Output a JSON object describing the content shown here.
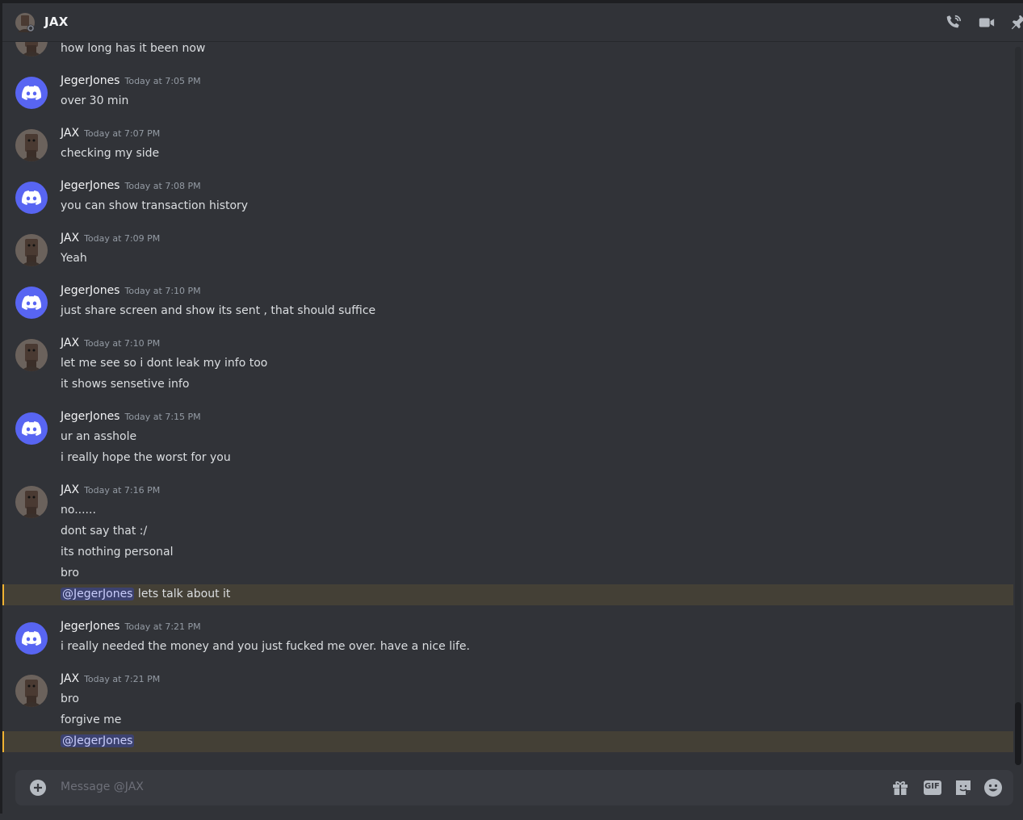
{
  "header": {
    "title": "JAX",
    "icons": [
      "phone-call-icon",
      "video-call-icon",
      "pin-icon"
    ]
  },
  "messages": [
    {
      "author": "",
      "time": "",
      "lines": [
        "how long has it been now"
      ]
    },
    {
      "author": "JegerJones",
      "time": "Today at 7:05 PM",
      "lines": [
        "over 30 min"
      ]
    },
    {
      "author": "JAX",
      "time": "Today at 7:07 PM",
      "lines": [
        "checking my side"
      ]
    },
    {
      "author": "JegerJones",
      "time": "Today at 7:08 PM",
      "lines": [
        "you can show transaction history"
      ]
    },
    {
      "author": "JAX",
      "time": "Today at 7:09 PM",
      "lines": [
        "Yeah"
      ]
    },
    {
      "author": "JegerJones",
      "time": "Today at 7:10 PM",
      "lines": [
        "just share screen and show its sent , that should suffice"
      ]
    },
    {
      "author": "JAX",
      "time": "Today at 7:10 PM",
      "lines": [
        "let me see so i dont leak my info too",
        "it shows sensetive info"
      ]
    },
    {
      "author": "JegerJones",
      "time": "Today at 7:15 PM",
      "lines": [
        "ur an asshole",
        "i really hope the worst for you"
      ]
    },
    {
      "author": "JAX",
      "time": "Today at 7:16 PM",
      "lines": [
        "no......",
        "dont say that :/",
        "its nothing personal",
        "bro"
      ],
      "mention_line": {
        "mention": "@JegerJones",
        "text": " lets talk about it"
      }
    },
    {
      "author": "JegerJones",
      "time": "Today at 7:21 PM",
      "lines": [
        "i really needed the money and you just fucked me over. have a nice life."
      ]
    },
    {
      "author": "JAX",
      "time": "Today at 7:21 PM",
      "lines": [
        "bro",
        "forgive me"
      ],
      "mention_line": {
        "mention": "@JegerJones",
        "text": ""
      }
    }
  ],
  "composer": {
    "placeholder": "Message @JAX",
    "gif_label": "GIF"
  },
  "colors": {
    "background": "#313338",
    "blurple": "#5865f2",
    "mention_highlight": "#444036",
    "mention_bar": "#f0b232"
  }
}
